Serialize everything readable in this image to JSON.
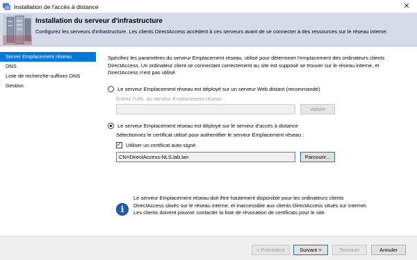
{
  "window": {
    "title": "Installation de l'accès à distance",
    "close_glyph": "✕"
  },
  "header": {
    "title": "Installation du serveur d'infrastructure",
    "description": "Configurez les serveurs d'infrastructure. Les clients DirectAccess accèdent à ces serveurs avant de se connecter à des ressources sur le réseau interne."
  },
  "sidebar": {
    "items": [
      {
        "label": "Server Emplacement réseau",
        "active": true
      },
      {
        "label": "DNS",
        "active": false
      },
      {
        "label": "Liste de recherche-suffixes DNS",
        "active": false
      },
      {
        "label": "Gestion",
        "active": false
      }
    ]
  },
  "main": {
    "intro": "Spécifiez les paramètres du serveur Emplacement réseau, utilisé pour déterminer l'emplacement des ordinateurs clients DirectAccess. Un ordinateur client se connectant correctement au site est supposé se trouver sur le réseau interne, et DirectAccess n'est pas utilisé.",
    "option_remote": {
      "label": "Le serveur Emplacement réseau est déployé sur un serveur Web distant (recommandé)",
      "checked": false,
      "url_prompt": "Entrez l'URL du serveur Emplacement réseau :",
      "url_value": "",
      "validate_button": "Valider"
    },
    "option_local": {
      "label": "Le serveur Emplacement réseau est déployé sur le serveur d'accès à distance",
      "checked": true,
      "cert_prompt": "Sélectionnez le certificat utilisé pour authentifier le serveur Emplacement réseau :",
      "self_signed_label": "Utiliser un certificat auto-signé",
      "self_signed_checked": true,
      "cert_value": "CN=DirectAccess-NLS.lab.lan",
      "browse_button": "Parcourir..."
    },
    "info": {
      "icon": "info-icon",
      "text": "Le serveur Emplacement réseau doit être hautement disponible pour les ordinateurs clients DirectAccess situés sur le réseau interne, et inaccessible aux clients DirectAccess situés sur Internet. Les clients doivent pouvoir contacter la liste de révocation de certificats pour le site."
    }
  },
  "footer": {
    "previous": "< Précédent",
    "next": "Suivant >",
    "finish": "Terminer",
    "cancel": "Annuler"
  },
  "colors": {
    "accent": "#0078d7",
    "header_bg": "#d6dbe9",
    "info_icon": "#1f5fb5"
  }
}
